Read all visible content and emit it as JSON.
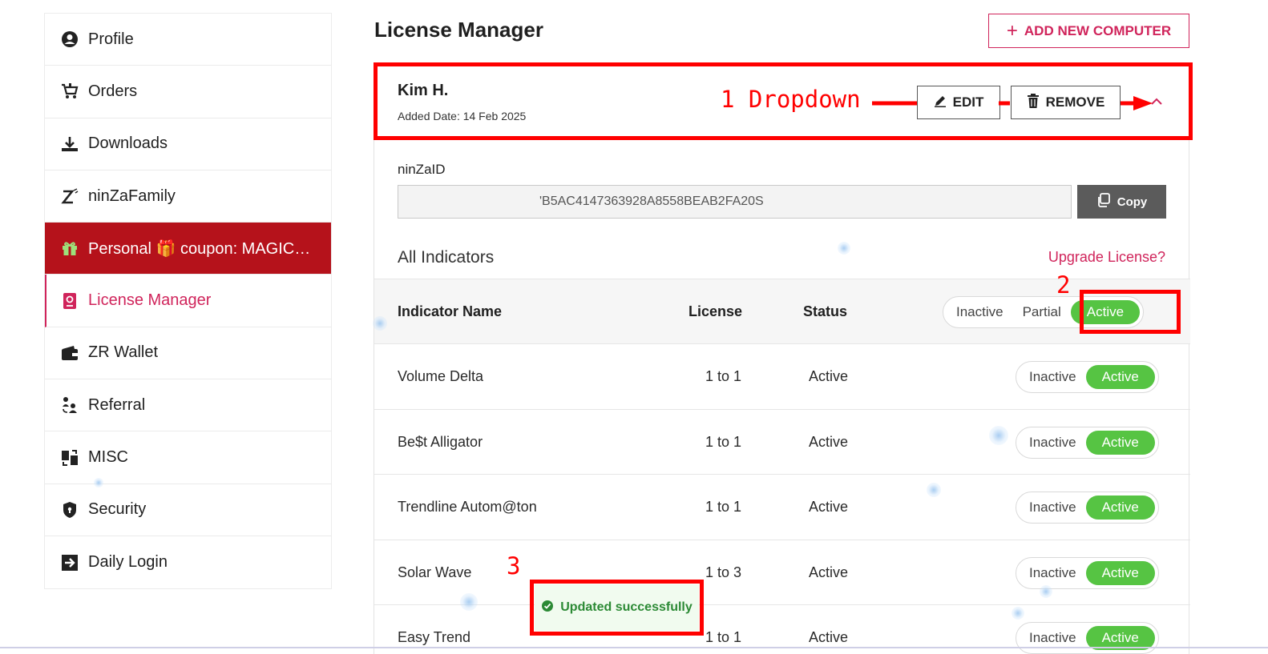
{
  "sidebar": {
    "items": [
      {
        "label": "Profile",
        "icon": "user-circle-icon"
      },
      {
        "label": "Orders",
        "icon": "cart-icon"
      },
      {
        "label": "Downloads",
        "icon": "download-icon"
      },
      {
        "label": "ninZaFamily",
        "icon": "ninza-z-icon"
      },
      {
        "label": "Personal 🎁 coupon: MAGICAL...",
        "icon": "gift-icon"
      },
      {
        "label": "License Manager",
        "icon": "license-icon"
      },
      {
        "label": "ZR Wallet",
        "icon": "wallet-icon"
      },
      {
        "label": "Referral",
        "icon": "referral-icon"
      },
      {
        "label": "MISC",
        "icon": "misc-icon"
      },
      {
        "label": "Security",
        "icon": "shield-icon"
      },
      {
        "label": "Daily Login",
        "icon": "login-icon"
      }
    ]
  },
  "header": {
    "title": "License Manager",
    "add_button": "ADD NEW COMPUTER"
  },
  "computer": {
    "name": "Kim H.",
    "added_date": "Added Date: 14 Feb 2025",
    "edit_label": "EDIT",
    "remove_label": "REMOVE",
    "id_label": "ninZaID",
    "id_value": "'B5AC4147363928A8558BEAB2FA20S",
    "copy_label": "Copy"
  },
  "indicators": {
    "section_title": "All Indicators",
    "upgrade_link": "Upgrade License?",
    "columns": {
      "name": "Indicator Name",
      "license": "License",
      "status": "Status"
    },
    "bulk_toggle": {
      "inactive": "Inactive",
      "partial": "Partial",
      "active": "Active"
    },
    "rows": [
      {
        "name": "Volume Delta",
        "license": "1 to 1",
        "status": "Active",
        "toggle_off": "Inactive",
        "toggle_on": "Active"
      },
      {
        "name": "Be$t Alligator",
        "license": "1 to 1",
        "status": "Active",
        "toggle_off": "Inactive",
        "toggle_on": "Active"
      },
      {
        "name": "Trendline Autom@ton",
        "license": "1 to 1",
        "status": "Active",
        "toggle_off": "Inactive",
        "toggle_on": "Active"
      },
      {
        "name": "Solar Wave",
        "license": "1 to 3",
        "status": "Active",
        "toggle_off": "Inactive",
        "toggle_on": "Active"
      },
      {
        "name": "Easy Trend",
        "license": "1 to 1",
        "status": "Active",
        "toggle_off": "Inactive",
        "toggle_on": "Active"
      }
    ]
  },
  "annotations": {
    "label1": "1  Dropdown",
    "label2": "2",
    "label3": "3"
  },
  "toast": {
    "message": "Updated successfully"
  },
  "colors": {
    "accent": "#d0245b",
    "promo": "#b5121b",
    "active_green": "#56c443",
    "annotation_red": "#ff0000"
  }
}
